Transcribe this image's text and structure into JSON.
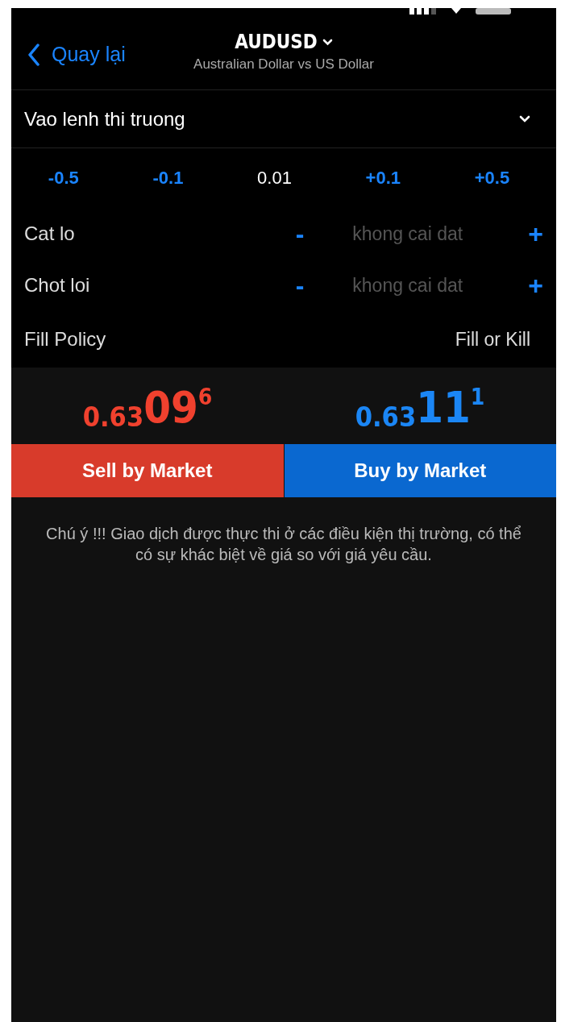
{
  "header": {
    "back": "Quay lại",
    "symbol": "AUDUSD",
    "description": "Australian Dollar vs US Dollar"
  },
  "order_type": {
    "value": "Vao lenh thi truong"
  },
  "volume": [
    {
      "kind": "step",
      "label": "-0.5"
    },
    {
      "kind": "step",
      "label": "-0.1"
    },
    {
      "kind": "value",
      "label": "0.01"
    },
    {
      "kind": "step",
      "label": "+0.1"
    },
    {
      "kind": "step",
      "label": "+0.5"
    }
  ],
  "levels": [
    {
      "label": "Cat lo",
      "minus": "-",
      "placeholder": "khong cai dat",
      "plus": "+"
    },
    {
      "label": "Chot loi",
      "minus": "-",
      "placeholder": "khong cai dat",
      "plus": "+"
    }
  ],
  "fill_policy": {
    "label": "Fill Policy",
    "value": "Fill or Kill"
  },
  "prices": [
    {
      "kind": "sell",
      "prefix": "0.63",
      "big": "09",
      "sup": "6",
      "button": "Sell by Market"
    },
    {
      "kind": "buy",
      "prefix": "0.63",
      "big": "11",
      "sup": "1",
      "button": "Buy by Market"
    }
  ],
  "notice": "Chú ý !!! Giao dịch được thực thi ở các điều kiện thị trường, có thể có sự khác biệt về giá so với giá yêu cầu."
}
